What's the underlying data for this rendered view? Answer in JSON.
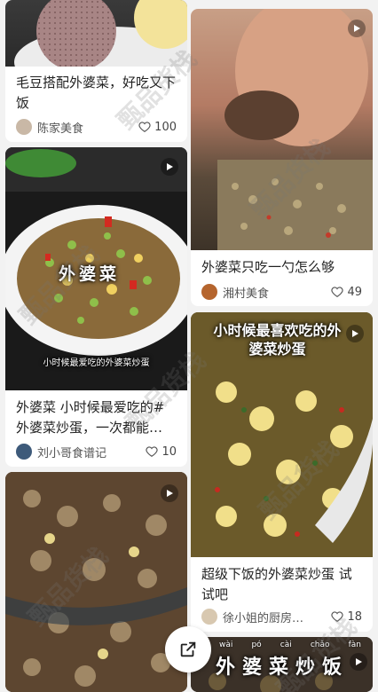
{
  "cards": [
    {
      "title": "毛豆搭配外婆菜，好吃又下饭",
      "author": "陈家美食",
      "likes": "100",
      "has_video": false
    },
    {
      "title": "外婆菜只吃一勺怎么够",
      "author": "湘村美食",
      "likes": "49",
      "has_video": true
    },
    {
      "title": "外婆菜 小时候最爱吃的#外婆菜炒蛋，一次都能…",
      "author": "刘小哥食谱记",
      "likes": "10",
      "has_video": true,
      "cover_big_text": "外婆菜",
      "cover_caption": "小时候最爱吃的外婆菜炒蛋"
    },
    {
      "title": "超级下饭的外婆菜炒蛋 试试吧",
      "author": "徐小姐的厨房…",
      "likes": "18",
      "has_video": true,
      "cover_text": "小时候最喜欢吃的外婆菜炒蛋"
    },
    {
      "cover_text": "外婆菜炒饭",
      "pinyin": [
        "wài",
        "pó",
        "cài",
        "chǎo",
        "fàn"
      ],
      "has_video": true
    }
  ],
  "watermark": "甄品货栈",
  "icons": {
    "play": "play-icon",
    "heart": "heart-outline-icon",
    "share": "share-icon"
  },
  "colors": {
    "background": "#f2f2f2",
    "card": "#ffffff",
    "text": "#222222",
    "meta": "#555555"
  }
}
